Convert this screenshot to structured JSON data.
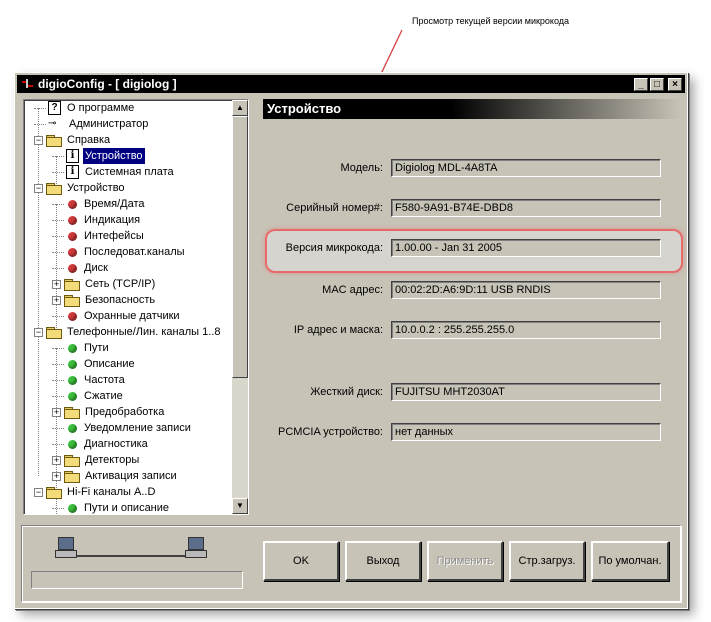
{
  "callout": "Просмотр текущей версии микрокода",
  "window": {
    "title": "digioConfig - [ digiolog ]",
    "controls": {
      "minimize": "_",
      "maximize": "□",
      "close": "×"
    }
  },
  "tree": {
    "items": [
      {
        "label": "О программе",
        "icon": "question-icon",
        "level": 0
      },
      {
        "label": "Администратор",
        "icon": "key-icon",
        "level": 0
      },
      {
        "label": "Справка",
        "icon": "folder-open-icon",
        "level": 0,
        "expander": "−"
      },
      {
        "label": "Устройство",
        "icon": "info-icon",
        "level": 1,
        "selected": true
      },
      {
        "label": "Системная плата",
        "icon": "info-icon",
        "level": 1
      },
      {
        "label": "Устройство",
        "icon": "folder-open-icon",
        "level": 0,
        "expander": "−"
      },
      {
        "label": "Время/Дата",
        "icon": "red-ball-icon",
        "level": 1
      },
      {
        "label": "Индикация",
        "icon": "red-ball-icon",
        "level": 1
      },
      {
        "label": "Интефейсы",
        "icon": "red-ball-icon",
        "level": 1
      },
      {
        "label": "Последоват.каналы",
        "icon": "red-ball-icon",
        "level": 1
      },
      {
        "label": "Диск",
        "icon": "red-ball-icon",
        "level": 1
      },
      {
        "label": "Сеть (TCP/IP)",
        "icon": "folder-icon",
        "level": 1,
        "expander": "+"
      },
      {
        "label": "Безопасность",
        "icon": "folder-icon",
        "level": 1,
        "expander": "+"
      },
      {
        "label": "Охранные датчики",
        "icon": "red-ball-icon",
        "level": 1
      },
      {
        "label": "Телефонные/Лин. каналы 1..8",
        "icon": "folder-open-icon",
        "level": 0,
        "expander": "−"
      },
      {
        "label": "Пути",
        "icon": "green-ball-icon",
        "level": 1
      },
      {
        "label": "Описание",
        "icon": "green-ball-icon",
        "level": 1
      },
      {
        "label": "Частота",
        "icon": "green-ball-icon",
        "level": 1
      },
      {
        "label": "Сжатие",
        "icon": "green-ball-icon",
        "level": 1
      },
      {
        "label": "Предобработка",
        "icon": "folder-icon",
        "level": 1,
        "expander": "+"
      },
      {
        "label": "Уведомление записи",
        "icon": "green-ball-icon",
        "level": 1
      },
      {
        "label": "Диагностика",
        "icon": "green-ball-icon",
        "level": 1
      },
      {
        "label": "Детекторы",
        "icon": "folder-icon",
        "level": 1,
        "expander": "+"
      },
      {
        "label": "Активация записи",
        "icon": "folder-icon",
        "level": 1,
        "expander": "+"
      },
      {
        "label": "Hi-Fi каналы A..D",
        "icon": "folder-open-icon",
        "level": 0,
        "expander": "−"
      },
      {
        "label": "Пути и описание",
        "icon": "green-ball-icon",
        "level": 1
      }
    ],
    "scroll_up": "▲",
    "scroll_down": "▼"
  },
  "section_title": "Устройство",
  "fields": {
    "model": {
      "label": "Модель:",
      "value": "Digiolog MDL-4A8TA"
    },
    "serial": {
      "label": "Серийный номер#:",
      "value": "F580-9A91-B74E-DBD8"
    },
    "firmware": {
      "label": "Версия микрокода:",
      "value": "1.00.00 - Jan 31 2005"
    },
    "mac": {
      "label": "MAC адрес:",
      "value": "00:02:2D:A6:9D:11  USB RNDIS"
    },
    "ip": {
      "label": "IP адрес и маска:",
      "value": "10.0.0.2 : 255.255.255.0"
    },
    "disk": {
      "label": "Жесткий диск:",
      "value": "FUJITSU MHT2030AT"
    },
    "pcmcia": {
      "label": "PCMCIA устройство:",
      "value": "нет данных"
    }
  },
  "buttons": {
    "ok": "OK",
    "exit": "Выход",
    "apply": "Применить",
    "boot_page": "Стр.загруз.",
    "defaults": "По умолчан."
  }
}
